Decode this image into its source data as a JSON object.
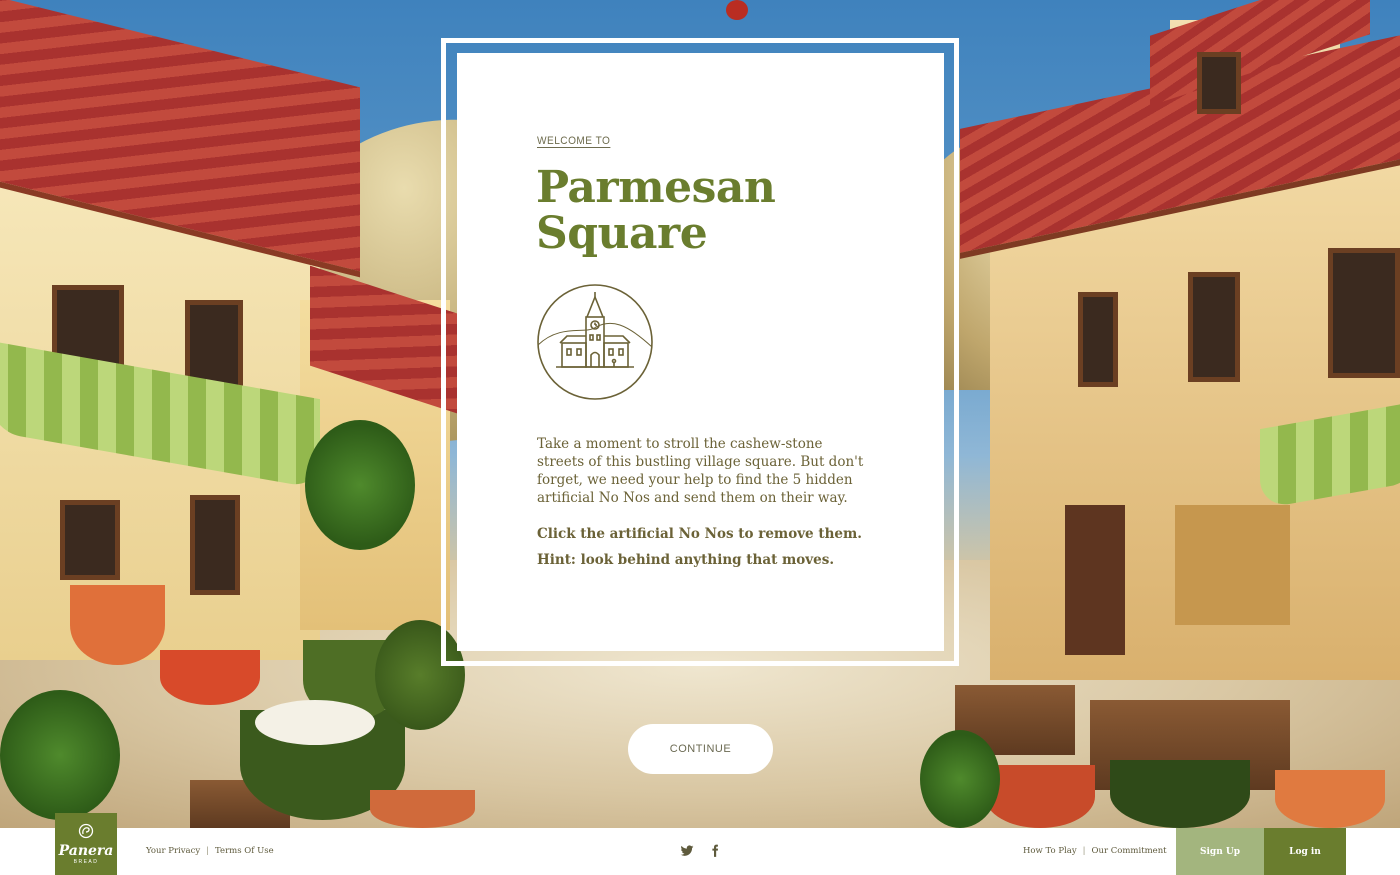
{
  "modal": {
    "eyebrow": "WELCOME TO",
    "title": "Parmesan Square",
    "emblem_icon": "clock-tower-icon",
    "description": "Take a moment to stroll the cashew-stone streets of this bustling village square. But don't forget, we need your help to find the 5 hidden artificial No Nos and send them on their way.",
    "instruction": "Click the artificial No Nos to remove them.",
    "hint": "Hint: look behind anything that moves."
  },
  "continue_label": "CONTINUE",
  "footer": {
    "logo": {
      "brand": "Panera",
      "sub": "BREAD"
    },
    "left_links": [
      "Your Privacy",
      "Terms Of Use"
    ],
    "social": [
      "twitter-icon",
      "facebook-icon"
    ],
    "right_links": [
      "How To Play",
      "Our Commitment"
    ],
    "signup_label": "Sign Up",
    "login_label": "Log in"
  },
  "colors": {
    "brand_green": "#6a7d2e",
    "light_green": "#a3b57e",
    "text_olive": "#6b6237"
  }
}
